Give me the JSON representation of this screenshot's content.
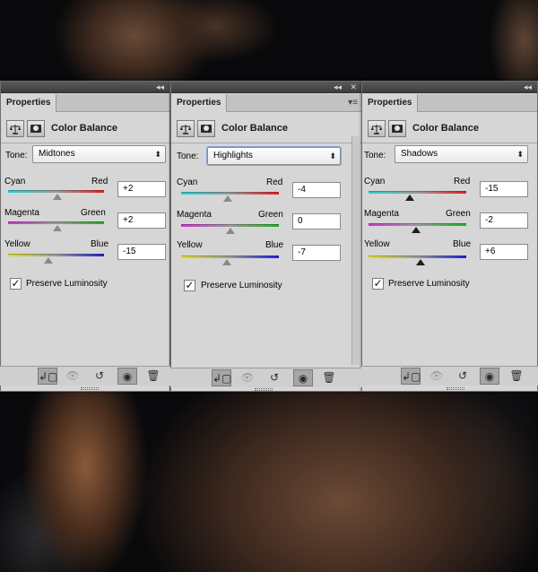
{
  "panels": [
    {
      "id": "left",
      "tab": "Properties",
      "title": "Color Balance",
      "tone_label": "Tone:",
      "tone": "Midtones",
      "channels": [
        {
          "left": "Cyan",
          "right": "Red",
          "value": "+2",
          "level": 2
        },
        {
          "left": "Magenta",
          "right": "Green",
          "value": "+2",
          "level": 2
        },
        {
          "left": "Yellow",
          "right": "Blue",
          "value": "-15",
          "level": -15
        }
      ],
      "preserve_label": "Preserve Luminosity",
      "preserve_checked": true
    },
    {
      "id": "middle",
      "tab": "Properties",
      "title": "Color Balance",
      "tone_label": "Tone:",
      "tone": "Highlights",
      "channels": [
        {
          "left": "Cyan",
          "right": "Red",
          "value": "-4",
          "level": -4
        },
        {
          "left": "Magenta",
          "right": "Green",
          "value": "0",
          "level": 0
        },
        {
          "left": "Yellow",
          "right": "Blue",
          "value": "-7",
          "level": -7
        }
      ],
      "preserve_label": "Preserve Luminosity",
      "preserve_checked": true
    },
    {
      "id": "right",
      "tab": "Properties",
      "title": "Color Balance",
      "tone_label": "Tone:",
      "tone": "Shadows",
      "channels": [
        {
          "left": "Cyan",
          "right": "Red",
          "value": "-15",
          "level": -15
        },
        {
          "left": "Magenta",
          "right": "Green",
          "value": "-2",
          "level": -2
        },
        {
          "left": "Yellow",
          "right": "Blue",
          "value": "+6",
          "level": 6
        }
      ],
      "preserve_label": "Preserve Luminosity",
      "preserve_checked": true
    }
  ],
  "glyphs": {
    "collapse": "◂◂",
    "close": "✕",
    "panel_menu": "▾≡",
    "select_arrows": "⬍",
    "check": "✓",
    "clip": "↲▢",
    "eye_state": "👁",
    "reset": "↺",
    "eye": "◉",
    "trash": "🗑"
  }
}
